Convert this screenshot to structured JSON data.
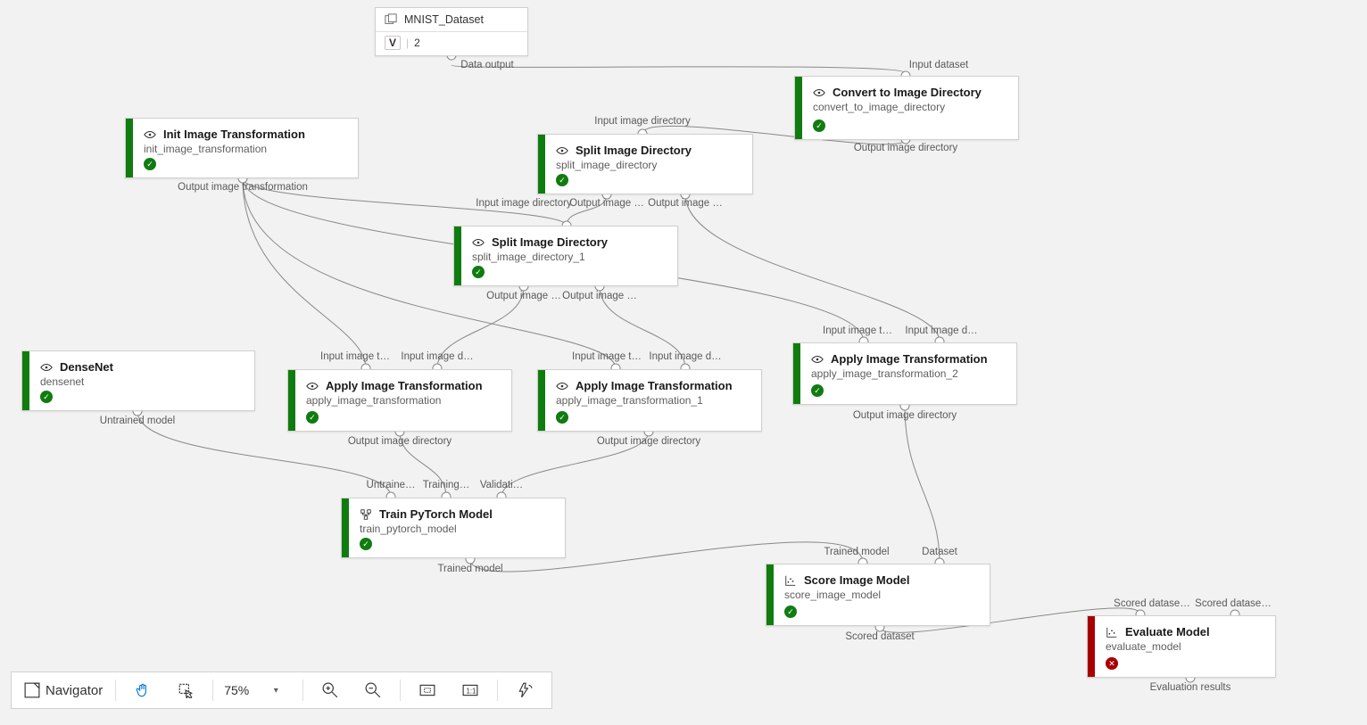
{
  "dataset": {
    "title": "MNIST_Dataset",
    "version_label": "V",
    "version_value": "2",
    "port_out_label": "Data output"
  },
  "nodes": {
    "convert": {
      "title": "Convert to Image Directory",
      "subtitle": "convert_to_image_directory",
      "in_label": "Input dataset",
      "out_label": "Output image directory"
    },
    "init": {
      "title": "Init Image Transformation",
      "subtitle": "init_image_transformation",
      "out_label": "Output image transformation"
    },
    "split1": {
      "title": "Split Image Directory",
      "subtitle": "split_image_directory",
      "in_label": "Input image directory",
      "out1": "Output image …",
      "out2": "Output image …",
      "in_overlap": "Input image directory"
    },
    "split2": {
      "title": "Split Image Directory",
      "subtitle": "split_image_directory_1",
      "out1": "Output image …",
      "out2": "Output image …"
    },
    "densenet": {
      "title": "DenseNet",
      "subtitle": "densenet",
      "out_label": "Untrained model"
    },
    "apply1": {
      "title": "Apply Image Transformation",
      "subtitle": "apply_image_transformation",
      "in1": "Input image t…",
      "in2": "Input image d…",
      "out": "Output image directory"
    },
    "apply2": {
      "title": "Apply Image Transformation",
      "subtitle": "apply_image_transformation_1",
      "in1": "Input image t…",
      "in2": "Input image d…",
      "out": "Output image directory"
    },
    "apply3": {
      "title": "Apply Image Transformation",
      "subtitle": "apply_image_transformation_2",
      "in1": "Input image t…",
      "in2": "Input image d…",
      "out": "Output image directory"
    },
    "train": {
      "title": "Train PyTorch Model",
      "subtitle": "train_pytorch_model",
      "in1": "Untraine…",
      "in2": "Training…",
      "in3": "Validati…",
      "out": "Trained model"
    },
    "score": {
      "title": "Score Image Model",
      "subtitle": "score_image_model",
      "in1": "Trained model",
      "in2": "Dataset",
      "out": "Scored dataset"
    },
    "eval": {
      "title": "Evaluate Model",
      "subtitle": "evaluate_model",
      "in1": "Scored datase…",
      "in2": "Scored datase…",
      "out": "Evaluation results"
    }
  },
  "toolbar": {
    "navigator": "Navigator",
    "zoom": "75%"
  },
  "icons": {
    "check": "✓",
    "cross": "✕"
  }
}
